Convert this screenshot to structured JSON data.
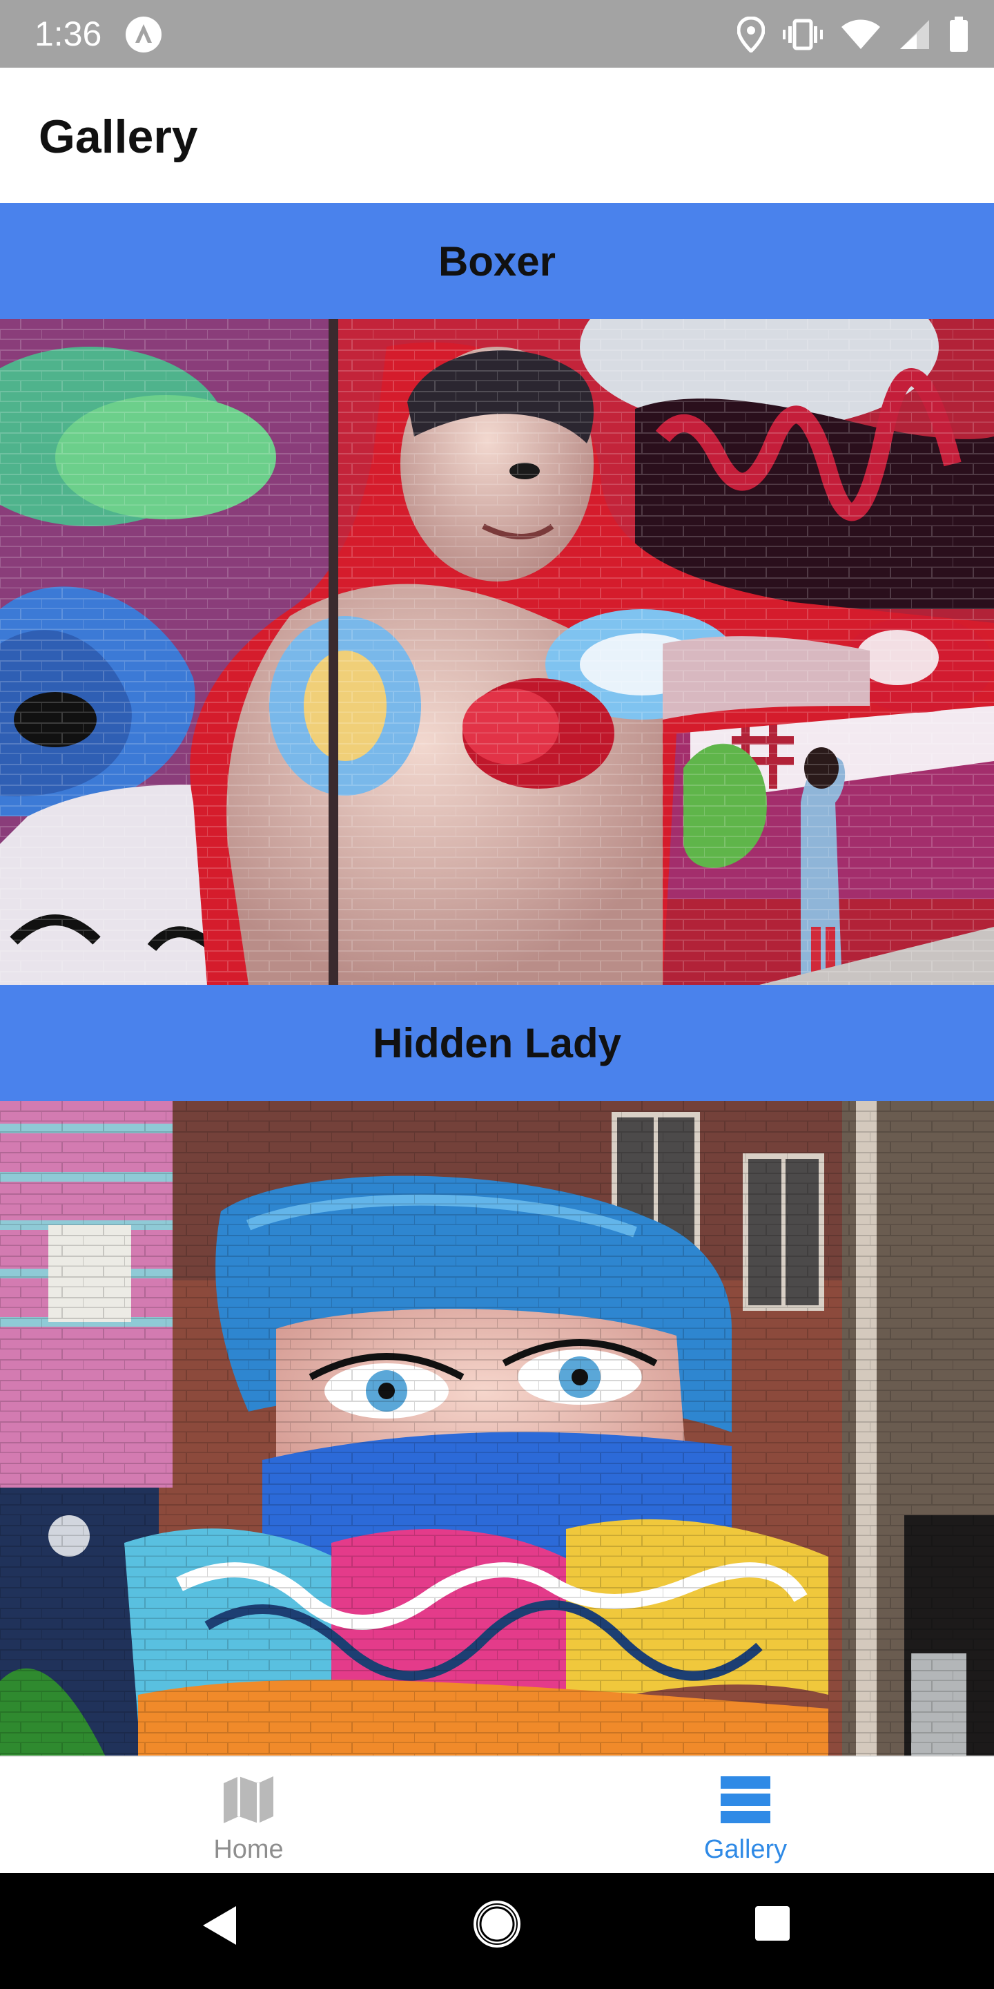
{
  "status_bar": {
    "time": "1:36",
    "background": "#a3a3a3"
  },
  "app_bar": {
    "title": "Gallery"
  },
  "gallery": {
    "accent": "#4a82ec",
    "items": [
      {
        "title": "Boxer",
        "image": "boxer-graffiti-mural"
      },
      {
        "title": "Hidden Lady",
        "image": "hidden-lady-graffiti-mural"
      }
    ]
  },
  "tabs": [
    {
      "label": "Home",
      "icon": "map-icon",
      "active": false
    },
    {
      "label": "Gallery",
      "icon": "list-icon",
      "active": true
    }
  ],
  "colors": {
    "tab_active": "#2f8ae6",
    "tab_inactive": "#8e8e8e"
  }
}
